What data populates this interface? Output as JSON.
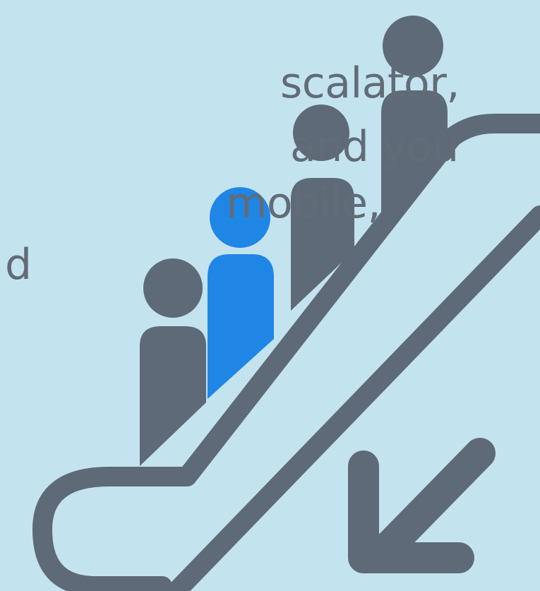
{
  "colors": {
    "background": "#c3e3ef",
    "figure_gray": "#5e6a77",
    "figure_blue": "#1f86e6",
    "text_gray": "#626c76",
    "ghost_text": "#b4d4e2"
  },
  "text": {
    "lines": [
      "scalator,",
      "and you",
      "mobile,",
      "d"
    ]
  },
  "icons": {
    "main": "escalator-people-icon",
    "arrow": "down-left-arrow-icon"
  }
}
